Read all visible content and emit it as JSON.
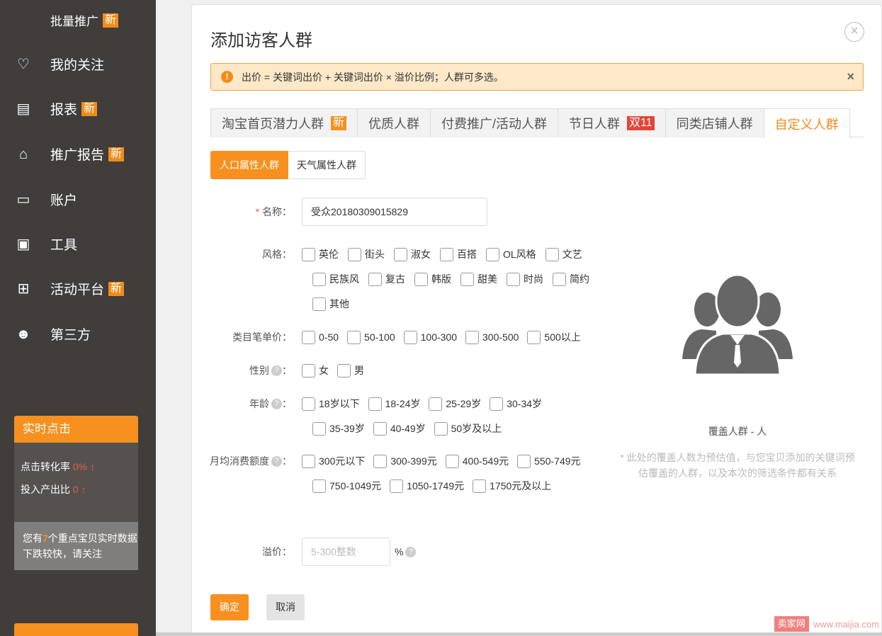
{
  "sidebar": {
    "items": [
      {
        "label": "批量推广",
        "badge": "新",
        "icon": "batch-icon"
      },
      {
        "label": "我的关注",
        "badge": "",
        "icon": "heart-icon"
      },
      {
        "label": "报表",
        "badge": "新",
        "icon": "report-icon"
      },
      {
        "label": "推广报告",
        "badge": "新",
        "icon": "chart-icon"
      },
      {
        "label": "账户",
        "badge": "",
        "icon": "id-card-icon"
      },
      {
        "label": "工具",
        "badge": "",
        "icon": "toolbox-icon"
      },
      {
        "label": "活动平台",
        "badge": "新",
        "icon": "gift-icon"
      },
      {
        "label": "第三方",
        "badge": "",
        "icon": "face-icon"
      }
    ],
    "realtime": {
      "title": "实时点击",
      "ctr_label": "点击转化率",
      "ctr_value": "0%",
      "roi_label": "投入产出比",
      "roi_value": "0",
      "arrow": "↑",
      "notice_pre": "您有",
      "notice_count": "7",
      "notice_post": "个重点宝贝实时数据下跌较快，请关注"
    }
  },
  "modal": {
    "title": "添加访客人群",
    "close": "×",
    "alert": {
      "text": "出价 = 关键词出价 + 关键词出价 × 溢价比例；人群可多选。",
      "close": "×"
    },
    "tabs": [
      {
        "label": "淘宝首页潜力人群",
        "badge": "新",
        "badge_color": "#f7901e"
      },
      {
        "label": "优质人群",
        "badge": ""
      },
      {
        "label": "付费推广/活动人群",
        "badge": ""
      },
      {
        "label": "节日人群",
        "badge": "双11",
        "badge_color": "#e4453a"
      },
      {
        "label": "同类店铺人群",
        "badge": ""
      },
      {
        "label": "自定义人群",
        "badge": "",
        "active": true
      }
    ],
    "subtabs": [
      "人口属性人群",
      "天气属性人群"
    ],
    "form": {
      "name_label": "名称：",
      "name_value": "受众20180309015829",
      "style_label": "风格：",
      "style_rows": [
        [
          "英伦",
          "街头",
          "淑女",
          "百搭",
          "OL风格",
          "文艺"
        ],
        [
          "民族风",
          "复古",
          "韩版",
          "甜美",
          "时尚",
          "简约"
        ],
        [
          "其他"
        ]
      ],
      "price_label": "类目笔单价：",
      "price_options": [
        "0-50",
        "50-100",
        "100-300",
        "300-500",
        "500以上"
      ],
      "gender_label": "性别",
      "gender_options": [
        "女",
        "男"
      ],
      "age_label": "年龄",
      "age_rows": [
        [
          "18岁以下",
          "18-24岁",
          "25-29岁",
          "30-34岁"
        ],
        [
          "35-39岁",
          "40-49岁",
          "50岁及以上"
        ]
      ],
      "spend_label": "月均消费额度",
      "spend_rows": [
        [
          "300元以下",
          "300-399元",
          "400-549元",
          "550-749元"
        ],
        [
          "750-1049元",
          "1050-1749元",
          "1750元及以上"
        ]
      ],
      "premium_label": "溢价：",
      "premium_placeholder": "5-300整数",
      "premium_unit": "%"
    },
    "coverage": {
      "text": "覆盖人群 - 人",
      "note": "* 此处的覆盖人数为预估值，与您宝贝添加的关键词预估覆盖的人群，以及本次的筛选条件都有关系"
    },
    "confirm": "确定",
    "cancel": "取消"
  },
  "watermark": {
    "brand": "卖家网",
    "url": "www.maijia.com"
  },
  "colors": {
    "accent": "#f7901e",
    "sidebar": "#403d3a"
  }
}
